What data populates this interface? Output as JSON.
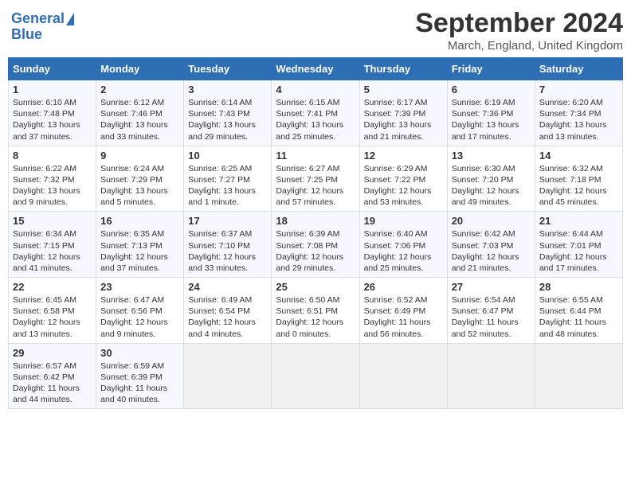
{
  "logo": {
    "line1": "General",
    "line2": "Blue"
  },
  "title": "September 2024",
  "subtitle": "March, England, United Kingdom",
  "weekdays": [
    "Sunday",
    "Monday",
    "Tuesday",
    "Wednesday",
    "Thursday",
    "Friday",
    "Saturday"
  ],
  "weeks": [
    [
      {
        "day": "1",
        "info": "Sunrise: 6:10 AM\nSunset: 7:48 PM\nDaylight: 13 hours\nand 37 minutes."
      },
      {
        "day": "2",
        "info": "Sunrise: 6:12 AM\nSunset: 7:46 PM\nDaylight: 13 hours\nand 33 minutes."
      },
      {
        "day": "3",
        "info": "Sunrise: 6:14 AM\nSunset: 7:43 PM\nDaylight: 13 hours\nand 29 minutes."
      },
      {
        "day": "4",
        "info": "Sunrise: 6:15 AM\nSunset: 7:41 PM\nDaylight: 13 hours\nand 25 minutes."
      },
      {
        "day": "5",
        "info": "Sunrise: 6:17 AM\nSunset: 7:39 PM\nDaylight: 13 hours\nand 21 minutes."
      },
      {
        "day": "6",
        "info": "Sunrise: 6:19 AM\nSunset: 7:36 PM\nDaylight: 13 hours\nand 17 minutes."
      },
      {
        "day": "7",
        "info": "Sunrise: 6:20 AM\nSunset: 7:34 PM\nDaylight: 13 hours\nand 13 minutes."
      }
    ],
    [
      {
        "day": "8",
        "info": "Sunrise: 6:22 AM\nSunset: 7:32 PM\nDaylight: 13 hours\nand 9 minutes."
      },
      {
        "day": "9",
        "info": "Sunrise: 6:24 AM\nSunset: 7:29 PM\nDaylight: 13 hours\nand 5 minutes."
      },
      {
        "day": "10",
        "info": "Sunrise: 6:25 AM\nSunset: 7:27 PM\nDaylight: 13 hours\nand 1 minute."
      },
      {
        "day": "11",
        "info": "Sunrise: 6:27 AM\nSunset: 7:25 PM\nDaylight: 12 hours\nand 57 minutes."
      },
      {
        "day": "12",
        "info": "Sunrise: 6:29 AM\nSunset: 7:22 PM\nDaylight: 12 hours\nand 53 minutes."
      },
      {
        "day": "13",
        "info": "Sunrise: 6:30 AM\nSunset: 7:20 PM\nDaylight: 12 hours\nand 49 minutes."
      },
      {
        "day": "14",
        "info": "Sunrise: 6:32 AM\nSunset: 7:18 PM\nDaylight: 12 hours\nand 45 minutes."
      }
    ],
    [
      {
        "day": "15",
        "info": "Sunrise: 6:34 AM\nSunset: 7:15 PM\nDaylight: 12 hours\nand 41 minutes."
      },
      {
        "day": "16",
        "info": "Sunrise: 6:35 AM\nSunset: 7:13 PM\nDaylight: 12 hours\nand 37 minutes."
      },
      {
        "day": "17",
        "info": "Sunrise: 6:37 AM\nSunset: 7:10 PM\nDaylight: 12 hours\nand 33 minutes."
      },
      {
        "day": "18",
        "info": "Sunrise: 6:39 AM\nSunset: 7:08 PM\nDaylight: 12 hours\nand 29 minutes."
      },
      {
        "day": "19",
        "info": "Sunrise: 6:40 AM\nSunset: 7:06 PM\nDaylight: 12 hours\nand 25 minutes."
      },
      {
        "day": "20",
        "info": "Sunrise: 6:42 AM\nSunset: 7:03 PM\nDaylight: 12 hours\nand 21 minutes."
      },
      {
        "day": "21",
        "info": "Sunrise: 6:44 AM\nSunset: 7:01 PM\nDaylight: 12 hours\nand 17 minutes."
      }
    ],
    [
      {
        "day": "22",
        "info": "Sunrise: 6:45 AM\nSunset: 6:58 PM\nDaylight: 12 hours\nand 13 minutes."
      },
      {
        "day": "23",
        "info": "Sunrise: 6:47 AM\nSunset: 6:56 PM\nDaylight: 12 hours\nand 9 minutes."
      },
      {
        "day": "24",
        "info": "Sunrise: 6:49 AM\nSunset: 6:54 PM\nDaylight: 12 hours\nand 4 minutes."
      },
      {
        "day": "25",
        "info": "Sunrise: 6:50 AM\nSunset: 6:51 PM\nDaylight: 12 hours\nand 0 minutes."
      },
      {
        "day": "26",
        "info": "Sunrise: 6:52 AM\nSunset: 6:49 PM\nDaylight: 11 hours\nand 56 minutes."
      },
      {
        "day": "27",
        "info": "Sunrise: 6:54 AM\nSunset: 6:47 PM\nDaylight: 11 hours\nand 52 minutes."
      },
      {
        "day": "28",
        "info": "Sunrise: 6:55 AM\nSunset: 6:44 PM\nDaylight: 11 hours\nand 48 minutes."
      }
    ],
    [
      {
        "day": "29",
        "info": "Sunrise: 6:57 AM\nSunset: 6:42 PM\nDaylight: 11 hours\nand 44 minutes."
      },
      {
        "day": "30",
        "info": "Sunrise: 6:59 AM\nSunset: 6:39 PM\nDaylight: 11 hours\nand 40 minutes."
      },
      {
        "day": "",
        "info": ""
      },
      {
        "day": "",
        "info": ""
      },
      {
        "day": "",
        "info": ""
      },
      {
        "day": "",
        "info": ""
      },
      {
        "day": "",
        "info": ""
      }
    ]
  ]
}
